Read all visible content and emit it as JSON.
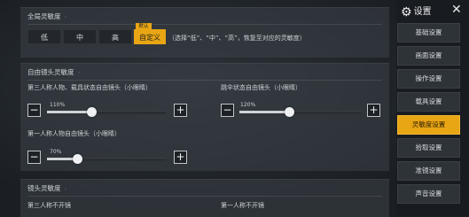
{
  "global": {
    "title": "全局灵敏度",
    "options": [
      "低",
      "中",
      "高",
      "自定义"
    ],
    "default_tag": "默认",
    "active_index": 3,
    "note": "（选择“低”、“中”、“高”，恢复至对应的灵敏度）"
  },
  "free_look": {
    "title": "自由镜头灵敏度",
    "tpp_label": "第三人称人物、载具状态自由镜头（小眼睛）",
    "tpp_value": "110%",
    "tpp_level": 0.45,
    "parachute_label": "跳伞状态自由镜头（小眼睛）",
    "parachute_value": "120%",
    "parachute_level": 0.5,
    "fpp_label": "第一人称人物自由镜头（小眼睛）",
    "fpp_value": "70%",
    "fpp_level": 0.33
  },
  "camera": {
    "title": "镜头灵敏度",
    "tpp_no_scope": "第三人称不开镜",
    "fpp_no_scope": "第一人称不开镜"
  },
  "sidebar": {
    "title": "设置",
    "items": [
      "基础设置",
      "画面设置",
      "操作设置",
      "载具设置",
      "灵敏度设置",
      "拾取设置",
      "准镜设置",
      "声音设置"
    ],
    "active_index": 4
  },
  "colors": {
    "accent": "#e8a514",
    "panel": "#3c4248",
    "background": "#1c2024"
  },
  "icons": {
    "minus": "−",
    "plus": "+",
    "gear": "⚙",
    "close": "✕"
  }
}
